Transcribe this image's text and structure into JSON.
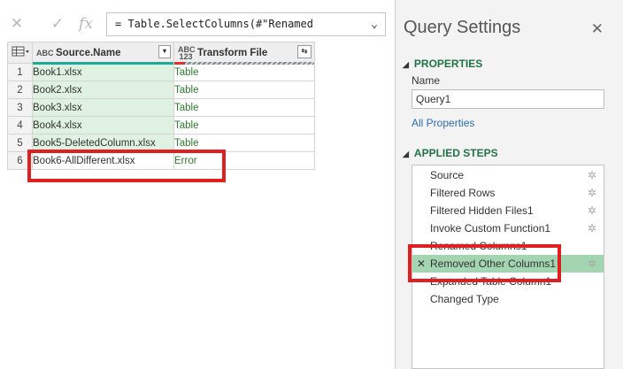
{
  "formula": {
    "cancel_icon": "✕",
    "confirm_icon": "✓",
    "fx_label": "fx",
    "text": "= Table.SelectColumns(#\"Renamed",
    "expand_icon": "⌄"
  },
  "grid": {
    "columns": [
      {
        "type_icon": "ABC",
        "name": "Source.Name"
      },
      {
        "type_icon": "ABC 123",
        "name": "Transform File"
      }
    ],
    "rows": [
      {
        "no": "1",
        "source": "Book1.xlsx",
        "transform": "Table"
      },
      {
        "no": "2",
        "source": "Book2.xlsx",
        "transform": "Table"
      },
      {
        "no": "3",
        "source": "Book3.xlsx",
        "transform": "Table"
      },
      {
        "no": "4",
        "source": "Book4.xlsx",
        "transform": "Table"
      },
      {
        "no": "5",
        "source": "Book5-DeletedColumn.xlsx",
        "transform": "Table"
      },
      {
        "no": "6",
        "source": "Book6-AllDifferent.xlsx",
        "transform": "Error"
      }
    ]
  },
  "query_settings": {
    "title": "Query Settings",
    "close_icon": "✕",
    "properties_heading": "PROPERTIES",
    "name_label": "Name",
    "name_value": "Query1",
    "all_properties_link": "All Properties",
    "applied_steps_heading": "APPLIED STEPS",
    "steps": [
      {
        "label": "Source",
        "gear": true
      },
      {
        "label": "Filtered Rows",
        "gear": true
      },
      {
        "label": "Filtered Hidden Files1",
        "gear": true
      },
      {
        "label": "Invoke Custom Function1",
        "gear": true
      },
      {
        "label": "Renamed Columns1",
        "gear": false
      },
      {
        "label": "Removed Other Columns1",
        "gear": true,
        "active": true
      },
      {
        "label": "Expanded Table Column1",
        "gear": false
      },
      {
        "label": "Changed Type",
        "gear": false
      }
    ]
  },
  "colors": {
    "highlight": "#e02020",
    "accent_green": "#217346",
    "active_step": "#a2d5b0"
  }
}
